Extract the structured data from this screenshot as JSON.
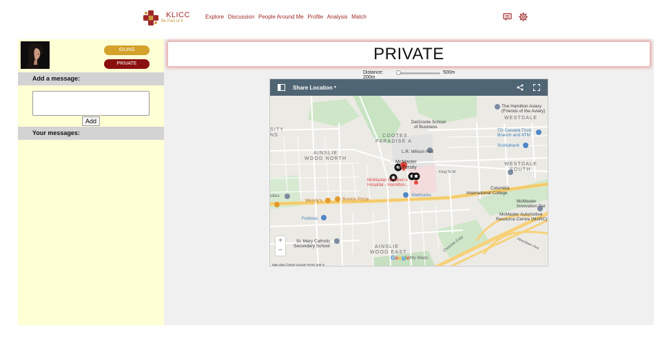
{
  "brand": {
    "name": "KLICC",
    "tagline": "Be Part of It",
    "color": "#a02828"
  },
  "nav": {
    "links": [
      "Explore",
      "Discussion",
      "People Around Me",
      "Profile",
      "Analysis",
      "Match"
    ],
    "icons": [
      "chat-icon",
      "gear-icon"
    ]
  },
  "sidebar": {
    "status_idle": "IDLING",
    "status_private": "PRIVATE",
    "add_message_heading": "Add a message:",
    "message_placeholder": "",
    "add_button": "Add",
    "your_messages_heading": "Your messages:",
    "colors": {
      "background": "#ffffd6",
      "idle": "#d4a12a",
      "private": "#8a0f0f"
    }
  },
  "main": {
    "title": "PRIVATE",
    "distance_label": "Distance: 200m",
    "distance_max": "500m",
    "slider_value": 0
  },
  "map": {
    "header_title": "Share Location",
    "labels": {
      "hamilton_aviary": "The Hamilton Aviary",
      "hamilton_aviary_2": "(Friends of the Aviary)",
      "westdale": "WESTDALE",
      "degroote": "DeGroote School",
      "degroote_2": "of Business",
      "cootes": "COOTES",
      "paradise": "PARADISE A",
      "city": "SITY",
      "ns": "NS",
      "td": "TD Canada Trust",
      "td_2": "Branch and ATM",
      "scotiabank": "Scotiabank",
      "wilson_hall": "L.R. Wilson Hall",
      "ainslie_wood_north": "AINSLIE",
      "ainslie_wood_north_2": "WOOD NORTH",
      "mcmaster": "McMaster",
      "university": "University",
      "westdale_south": "WESTDALE",
      "westdale_south_2": "SOUTH",
      "king_st": "King St W",
      "childrens": "McMaster Children's",
      "childrens_2": "Hospital - Hamilton...",
      "columbia": "Columbia",
      "columbia_2": "International College",
      "starbucks": "Starbucks",
      "suites": "uites",
      "wendys": "Wendy's",
      "boston_pizza": "Boston Pizza",
      "mcmaster_innovation": "McMaster",
      "mcmaster_innovation_2": "Innovation Par",
      "fortinos": "Fortinos",
      "mcmaster_auto": "McMaster Automotive",
      "mcmaster_auto_2": "Resource Centre (MARC)",
      "st_mary": "St. Mary Catholic",
      "st_mary_2": "Secondary School",
      "ainslie_wood_east": "AINSLIE",
      "ainslie_wood_east_2": "WOOD EAST",
      "my_maps": "My Maps",
      "cheddoke": "Chedoke Expy",
      "aberdeen": "Aberdeen Ave",
      "attribution": "Map data ©2020 Google   Terms   200 m"
    },
    "zoom_in": "+",
    "zoom_out": "−",
    "google": [
      "G",
      "o",
      "o",
      "g",
      "l",
      "e"
    ]
  }
}
